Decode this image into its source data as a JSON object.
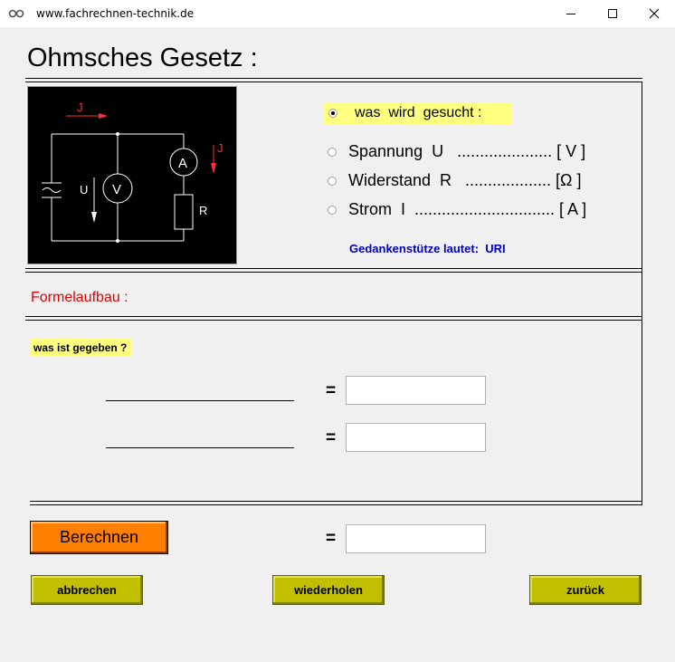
{
  "window": {
    "title": "www.fachrechnen-technik.de",
    "icon": "chain-link-icon"
  },
  "page": {
    "title": "Ohmsches Gesetz :"
  },
  "circuit": {
    "current_label": "J",
    "voltage_label": "U",
    "voltmeter_label": "V",
    "ammeter_label": "A",
    "resistor_label": "R",
    "source_symbol": "~"
  },
  "search": {
    "header": "was  wird  gesucht :",
    "options": [
      {
        "label": "Spannung  U   ..................... [ V ]"
      },
      {
        "label": "Widerstand  R   ................... [Ω ]"
      },
      {
        "label": "Strom  I  ............................... [ A ]"
      }
    ],
    "hint": "Gedankenstütze lautet:  URI"
  },
  "formula": {
    "label": "Formelaufbau :"
  },
  "given": {
    "label": "was ist gegeben ?",
    "equals": "="
  },
  "actions": {
    "calculate": "Berechnen",
    "cancel": "abbrechen",
    "repeat": "wiederholen",
    "back": "zurück"
  },
  "colors": {
    "highlight": "#ffff80",
    "calc_button": "#ff8000",
    "action_button": "#c0c000",
    "hint": "#0000c0",
    "formula": "#e00000"
  }
}
